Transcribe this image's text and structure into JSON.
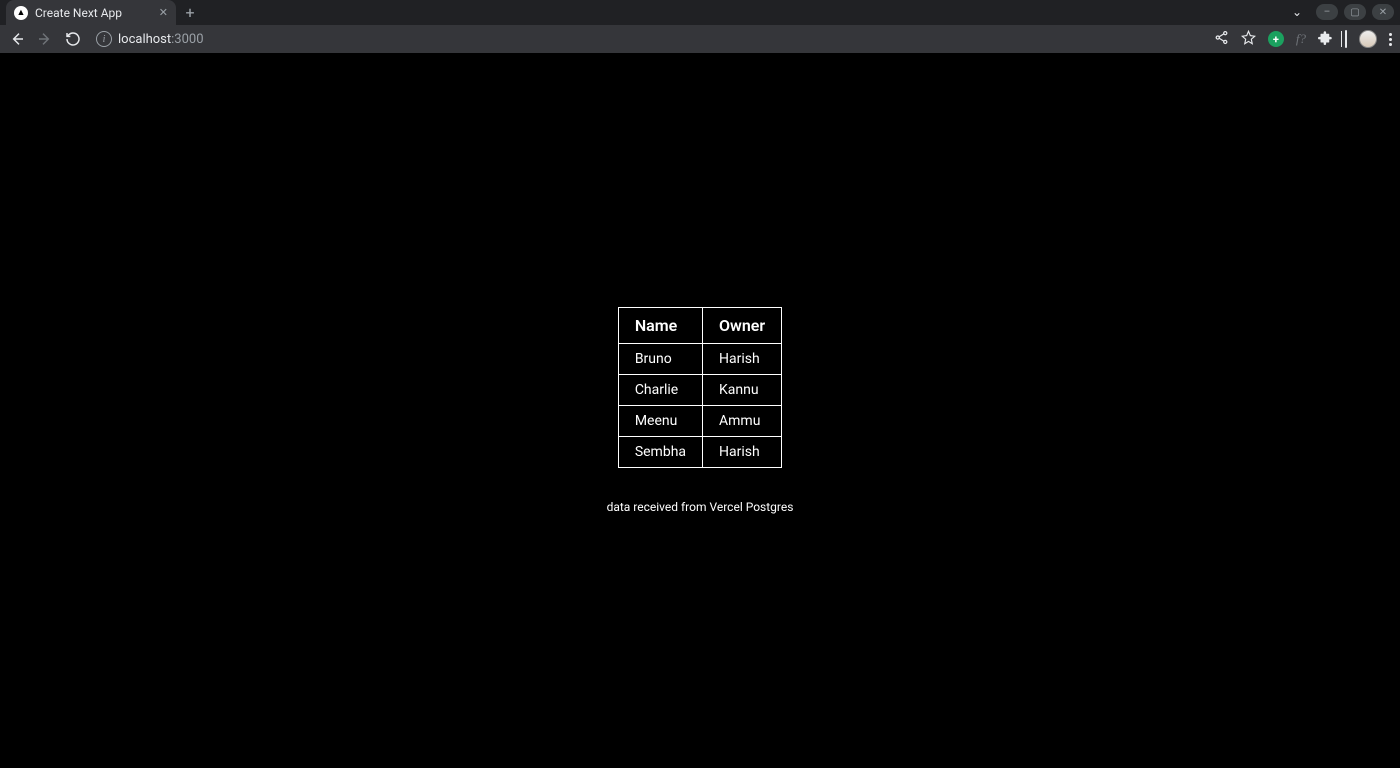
{
  "browser": {
    "tab_title": "Create Next App",
    "tab_favicon_glyph": "▲",
    "url_host": "localhost",
    "url_port": ":3000",
    "new_tab_glyph": "+",
    "close_glyph": "✕",
    "chevron": "⌄",
    "minimize_glyph": "–",
    "maximize_glyph": "▢",
    "window_close_glyph": "✕"
  },
  "page": {
    "table": {
      "headers": [
        "Name",
        "Owner"
      ],
      "rows": [
        {
          "name": "Bruno",
          "owner": "Harish"
        },
        {
          "name": "Charlie",
          "owner": "Kannu"
        },
        {
          "name": "Meenu",
          "owner": "Ammu"
        },
        {
          "name": "Sembha",
          "owner": "Harish"
        }
      ]
    },
    "caption": "data received from Vercel Postgres"
  }
}
